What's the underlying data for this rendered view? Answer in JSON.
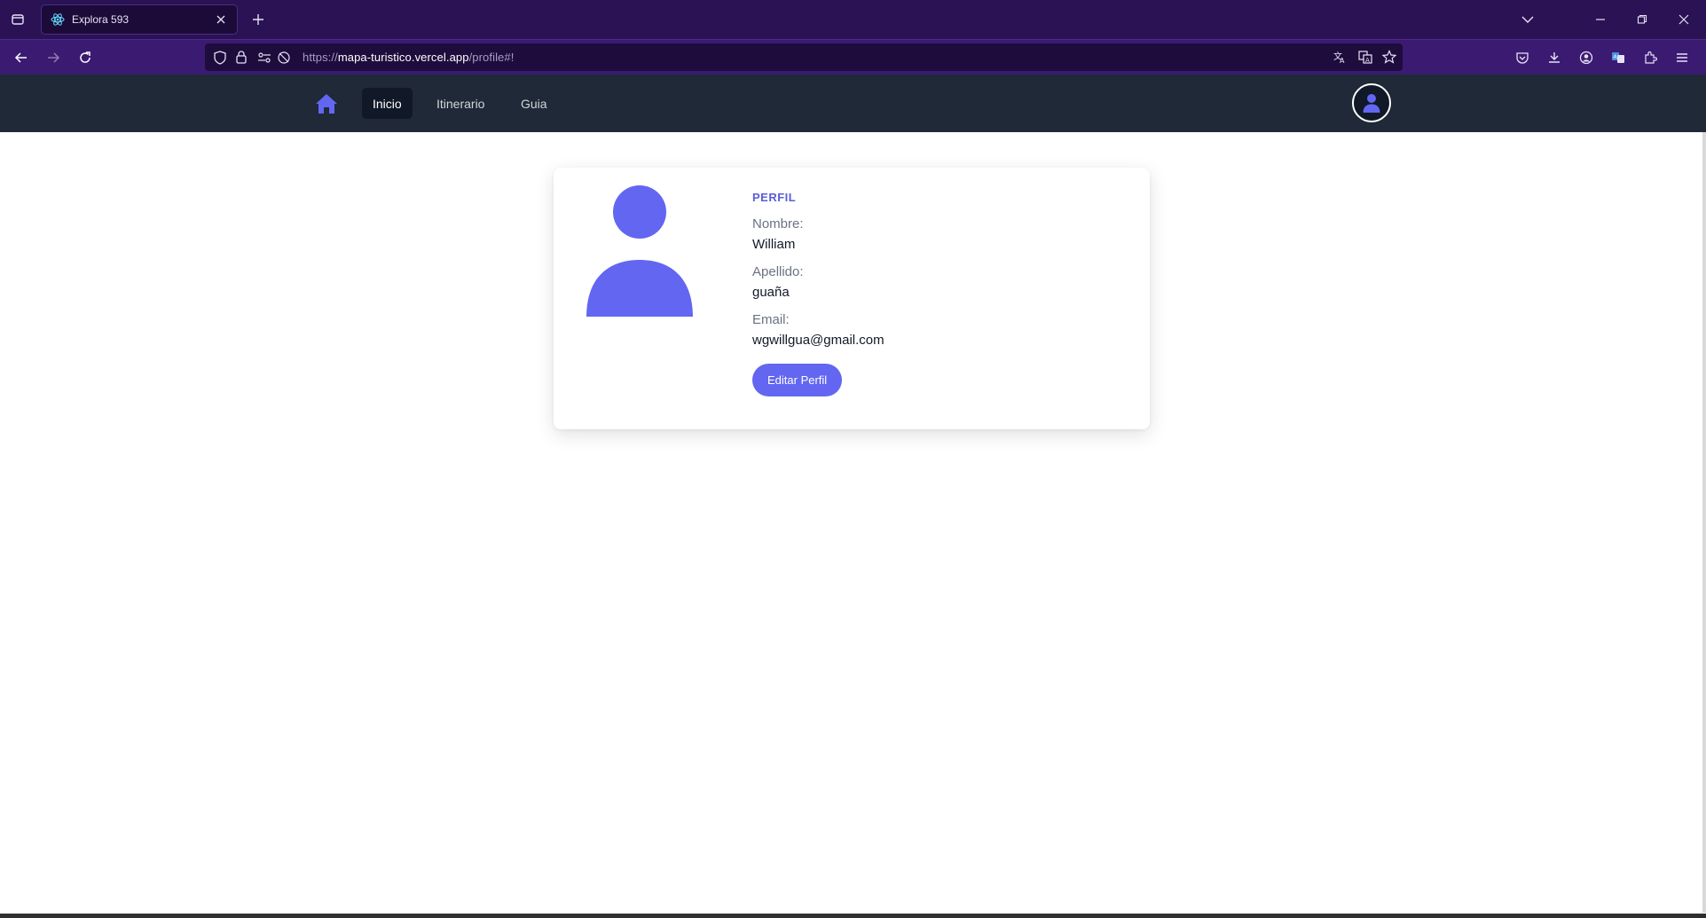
{
  "browser": {
    "tab_title": "Explora 593",
    "url_scheme": "https://",
    "url_host": "mapa-turistico.vercel.app",
    "url_path": "/profile#!"
  },
  "site": {
    "nav": [
      {
        "label": "Inicio",
        "active": true
      },
      {
        "label": "Itinerario",
        "active": false
      },
      {
        "label": "Guia",
        "active": false
      }
    ]
  },
  "profile": {
    "title": "PERFIL",
    "name_label": "Nombre:",
    "name_value": "William",
    "surname_label": "Apellido:",
    "surname_value": "guaña",
    "email_label": "Email:",
    "email_value": "wgwillgua@gmail.com",
    "edit_button": "Editar Perfil"
  },
  "colors": {
    "accent": "#6366f1",
    "header_bg": "#1f2937",
    "browser_bg": "#2a1254"
  }
}
